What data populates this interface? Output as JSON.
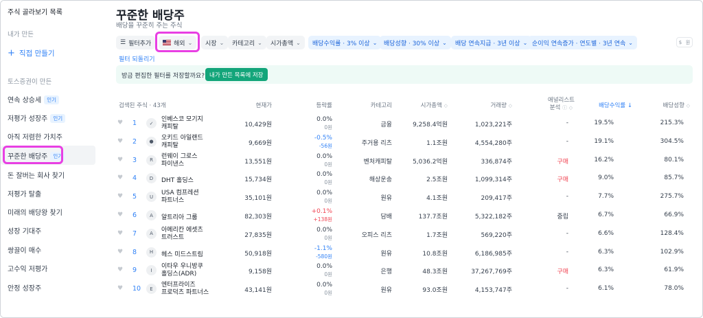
{
  "sidebar": {
    "header": "주식 골라보기 목록",
    "my_section": "내가 만든",
    "create_label": "직접 만들기",
    "toss_section": "토스증권이 만든",
    "popular_badge": "인기",
    "items": [
      {
        "label": "연속 상승세",
        "badge": true
      },
      {
        "label": "저평가 성장주",
        "badge": true
      },
      {
        "label": "아직 저렴한 가치주",
        "badge": false
      },
      {
        "label": "꾸준한 배당주",
        "badge": true
      },
      {
        "label": "돈 잘버는 회사 찾기",
        "badge": false
      },
      {
        "label": "저평가 탈출",
        "badge": false
      },
      {
        "label": "미래의 배당왕 찾기",
        "badge": false
      },
      {
        "label": "성장 기대주",
        "badge": false
      },
      {
        "label": "쌍끌이 매수",
        "badge": false
      },
      {
        "label": "고수익 저평가",
        "badge": false
      },
      {
        "label": "안정 성장주",
        "badge": false
      }
    ]
  },
  "page": {
    "title": "꾸준한 배당주",
    "subtitle": "배당을 꾸준히 주는 주식"
  },
  "filters": {
    "add_label": "필터추가",
    "country_label": "해외",
    "chips": [
      "시장",
      "카테고리",
      "시가총액"
    ],
    "active_chips": [
      "배당수익률 · 3% 이상",
      "배당성향 · 30% 이상",
      "배당 연속지급 · 3년 이상",
      "순이익 연속증가 · 연도별 · 3년 연속"
    ],
    "reset_label": "필터 되돌리기",
    "unit_a": "$",
    "unit_b": "원"
  },
  "save_banner": {
    "text": "방금 편집한 필터를 저장할까요?",
    "button": "내가 만든 목록에 저장"
  },
  "table": {
    "headers": {
      "count": "검색된 주식 · 43개",
      "price": "현재가",
      "change": "등락률",
      "category": "카테고리",
      "mcap": "시가총액",
      "volume": "거래량",
      "analyst_1": "애널리스트",
      "analyst_2": "분석",
      "yield": "배당수익률",
      "payout": "배당성향"
    },
    "rows": [
      {
        "rank": "1",
        "name1": "인베스코 모기지",
        "name2": "캐피탈",
        "price": "10,429원",
        "pct": "0.0%",
        "amt": "0원",
        "dir": "flat",
        "category": "금융",
        "mcap": "9,258.4억원",
        "volume": "1,023,221주",
        "analyst": "-",
        "yield": "19.5%",
        "payout": "215.3%",
        "logo": "✓"
      },
      {
        "rank": "2",
        "name1": "오키드 아일랜드",
        "name2": "캐피탈",
        "price": "9,669원",
        "pct": "-0.5%",
        "amt": "-56원",
        "dir": "down",
        "category": "주거용 리츠",
        "mcap": "1.1조원",
        "volume": "4,554,280주",
        "analyst": "-",
        "yield": "19.1%",
        "payout": "304.5%",
        "logo": "●"
      },
      {
        "rank": "3",
        "name1": "런웨이 그로스",
        "name2": "파이낸스",
        "price": "13,551원",
        "pct": "0.0%",
        "amt": "0원",
        "dir": "flat",
        "category": "벤처캐피탈",
        "mcap": "5,036.2억원",
        "volume": "336,874주",
        "analyst": "구매",
        "yield": "16.2%",
        "payout": "80.1%",
        "logo": "R"
      },
      {
        "rank": "4",
        "name1": "DHT 홀딩스",
        "name2": "",
        "price": "15,734원",
        "pct": "0.0%",
        "amt": "0원",
        "dir": "flat",
        "category": "해상운송",
        "mcap": "2.5조원",
        "volume": "1,099,314주",
        "analyst": "구매",
        "yield": "9.0%",
        "payout": "85.7%",
        "logo": "D"
      },
      {
        "rank": "5",
        "name1": "USA 컴프레션",
        "name2": "파트너스",
        "price": "35,101원",
        "pct": "0.0%",
        "amt": "0원",
        "dir": "flat",
        "category": "원유",
        "mcap": "4.1조원",
        "volume": "209,417주",
        "analyst": "-",
        "yield": "7.7%",
        "payout": "275.7%",
        "logo": "U"
      },
      {
        "rank": "6",
        "name1": "알트리아 그룹",
        "name2": "",
        "price": "82,303원",
        "pct": "+0.1%",
        "amt": "+138원",
        "dir": "up",
        "category": "담배",
        "mcap": "137.7조원",
        "volume": "5,322,182주",
        "analyst": "중립",
        "yield": "6.7%",
        "payout": "66.9%",
        "logo": "A"
      },
      {
        "rank": "7",
        "name1": "아메리칸 에셋츠",
        "name2": "트러스트",
        "price": "27,835원",
        "pct": "0.0%",
        "amt": "0원",
        "dir": "flat",
        "category": "오피스 리츠",
        "mcap": "1.7조원",
        "volume": "569,220주",
        "analyst": "-",
        "yield": "6.6%",
        "payout": "128.4%",
        "logo": "A"
      },
      {
        "rank": "8",
        "name1": "헤스 미드스트림",
        "name2": "",
        "price": "50,918원",
        "pct": "-1.1%",
        "amt": "-580원",
        "dir": "down",
        "category": "원유",
        "mcap": "10.8조원",
        "volume": "6,186,985주",
        "analyst": "-",
        "yield": "6.3%",
        "payout": "102.9%",
        "logo": "H"
      },
      {
        "rank": "9",
        "name1": "이타우 우니방쿠",
        "name2": "홀딩스(ADR)",
        "price": "9,158원",
        "pct": "0.0%",
        "amt": "0원",
        "dir": "flat",
        "category": "은행",
        "mcap": "48.3조원",
        "volume": "37,267,769주",
        "analyst": "구매",
        "yield": "6.3%",
        "payout": "61.9%",
        "logo": "I"
      },
      {
        "rank": "10",
        "name1": "엔터프라이즈",
        "name2": "프로덕츠 파트너스",
        "price": "43,141원",
        "pct": "0.0%",
        "amt": "0원",
        "dir": "flat",
        "category": "원유",
        "mcap": "93.0조원",
        "volume": "4,153,747주",
        "analyst": "-",
        "yield": "6.1%",
        "payout": "78.0%",
        "logo": "E"
      }
    ]
  },
  "colors": {
    "accent": "#3182f6",
    "highlight": "#e83fe3",
    "save_button": "#13a57a",
    "up": "#f04452"
  }
}
